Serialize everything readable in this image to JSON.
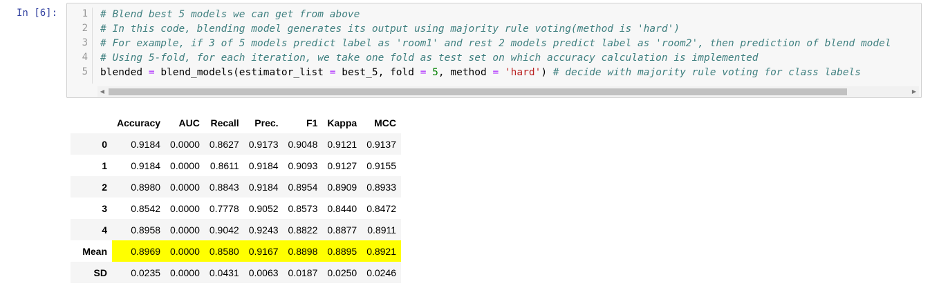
{
  "cell": {
    "prompt": "In [6]:",
    "line_numbers": [
      "1",
      "2",
      "3",
      "4",
      "5"
    ],
    "comment_lines": [
      "# Blend best 5 models we can get from above",
      "# In this code, blending model generates its output using majority rule voting(method is 'hard')",
      "# For example, if 3 of 5 models predict label as 'room1' and rest 2 models predict label as 'room2', then prediction of blend model",
      "# Using 5-fold, for each iteration, we take one fold as test set on which accuracy calculation is implemented"
    ],
    "code_line5": {
      "var": "blended",
      "eq1": " = ",
      "call": "blend_models(estimator_list ",
      "eq2": "=",
      "arg1": " best_5, fold ",
      "eq3": "=",
      "num": " 5",
      "arg2": ", method ",
      "eq4": "=",
      "str": " 'hard'",
      "close": ") ",
      "comment": "# decide with majority rule voting for class labels"
    },
    "scroll_left_icon": "triangle-left-icon",
    "scroll_right_icon": "triangle-right-icon"
  },
  "results": {
    "columns": [
      "",
      "Accuracy",
      "AUC",
      "Recall",
      "Prec.",
      "F1",
      "Kappa",
      "MCC"
    ],
    "rows": [
      {
        "label": "0",
        "values": [
          "0.9184",
          "0.0000",
          "0.8627",
          "0.9173",
          "0.9048",
          "0.9121",
          "0.9137"
        ]
      },
      {
        "label": "1",
        "values": [
          "0.9184",
          "0.0000",
          "0.8611",
          "0.9184",
          "0.9093",
          "0.9127",
          "0.9155"
        ]
      },
      {
        "label": "2",
        "values": [
          "0.8980",
          "0.0000",
          "0.8843",
          "0.9184",
          "0.8954",
          "0.8909",
          "0.8933"
        ]
      },
      {
        "label": "3",
        "values": [
          "0.8542",
          "0.0000",
          "0.7778",
          "0.9052",
          "0.8573",
          "0.8440",
          "0.8472"
        ]
      },
      {
        "label": "4",
        "values": [
          "0.8958",
          "0.0000",
          "0.9042",
          "0.9243",
          "0.8822",
          "0.8877",
          "0.8911"
        ]
      },
      {
        "label": "Mean",
        "values": [
          "0.8969",
          "0.0000",
          "0.8580",
          "0.9167",
          "0.8898",
          "0.8895",
          "0.8921"
        ]
      },
      {
        "label": "SD",
        "values": [
          "0.0235",
          "0.0000",
          "0.0431",
          "0.0063",
          "0.0187",
          "0.0250",
          "0.0246"
        ]
      }
    ],
    "highlight_row": "Mean",
    "highlight_color": "#ffff00"
  }
}
